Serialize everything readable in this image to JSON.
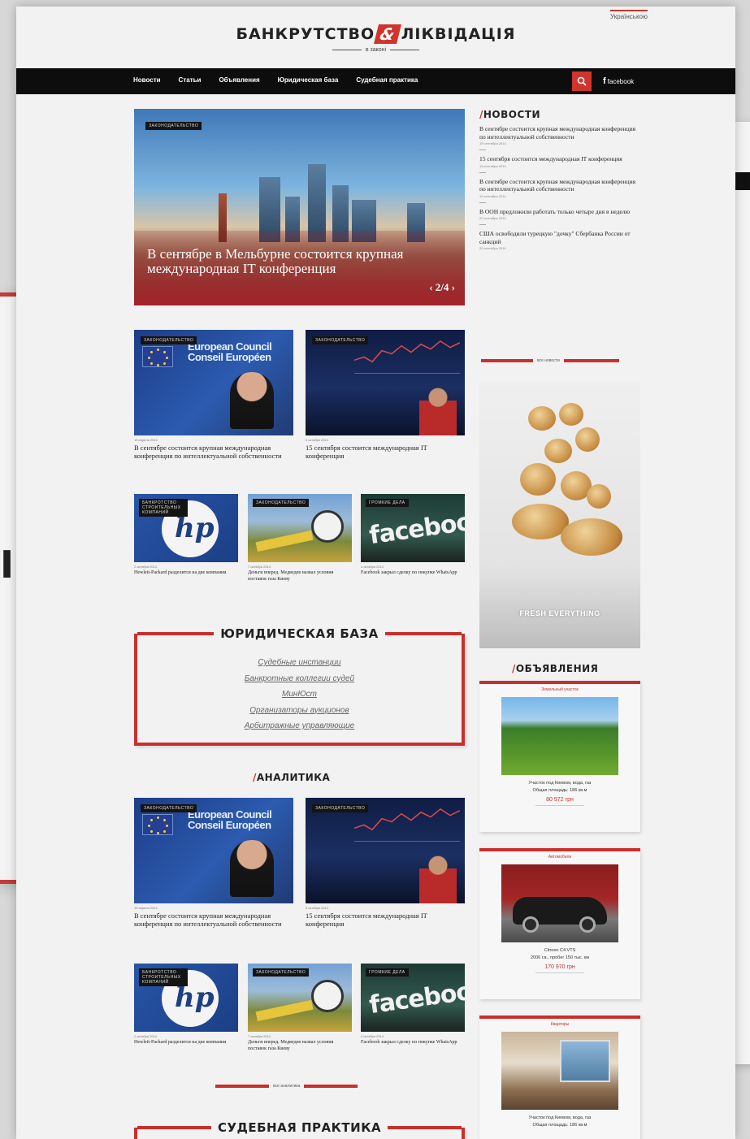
{
  "lang": "Українською",
  "logo": {
    "part1": "БАНКРУТСТВО",
    "amp": "&",
    "part2": "ЛІКВІДАЦІЯ",
    "subtitle": "в законі"
  },
  "nav": {
    "items": [
      "Новости",
      "Статьи",
      "Объявления",
      "Юридическая база",
      "Судебная практика"
    ],
    "facebook": "facebook"
  },
  "hero": {
    "tag": "законодательство",
    "title": "В сентябре в Мельбурне состоится крупная международная IT конференция",
    "pager": "2/4"
  },
  "articles_top": [
    {
      "tag": "законодательство",
      "date": "19 апреля 2014",
      "title": "В сентябре состоится крупная международная конференция по интеллектуальной собственности"
    },
    {
      "tag": "законодательство",
      "date": "3 октября 2014",
      "title": "15 сентября состоится международная IT конференция"
    }
  ],
  "articles_small": [
    {
      "tag": "банкротство строительных компаний",
      "date": "2 октября 2014",
      "title": "Hewlett-Packard разделится на две компании"
    },
    {
      "tag": "законодательство",
      "date": "7 октября 2014",
      "title": "Деньги вперед. Медведев назвал условия поставок газа Киеву"
    },
    {
      "tag": "громкие дела",
      "date": "4 октября 2014",
      "title": "Facebook закрыл сделку по покупке WhatsApp"
    }
  ],
  "legal_base": {
    "title": "ЮРИДИЧЕСКАЯ БАЗА",
    "links": [
      "Судебные инстанции",
      "Банкротные коллегии судей",
      "МинЮст",
      "Организаторы аукционов",
      "Арбитражные управляющие"
    ]
  },
  "analytics": {
    "title": "АНАЛИТИКА",
    "top": [
      {
        "tag": "законодательство",
        "date": "19 апреля 2014",
        "title": "В сентябре состоится крупная международная конференция по интеллектуальной собственности"
      },
      {
        "tag": "законодательство",
        "date": "3 октября 2014",
        "title": "15 сентября состоится международная IT конференция"
      }
    ],
    "small": [
      {
        "tag": "банкротство строительных компаний",
        "date": "2 октября 2014",
        "title": "Hewlett-Packard разделится на две компании"
      },
      {
        "tag": "законодательство",
        "date": "7 октября 2014",
        "title": "Деньги вперед. Медведев назвал условия поставок газа Киеву"
      },
      {
        "tag": "громкие дела",
        "date": "4 октября 2014",
        "title": "Facebook закрыл сделку по покупке WhatsApp"
      }
    ],
    "more": "все аналитика"
  },
  "court_practice": {
    "title": "СУДЕБНАЯ ПРАКТИКА"
  },
  "news": {
    "title": "НОВОСТИ",
    "items": [
      {
        "title": "В сентябре состоится крупная международная конференция по интеллектуальной собственности",
        "date": "19 сентября 2014"
      },
      {
        "title": "15 сентября состоится международная IT конференция",
        "date": "15 сентября 2014"
      },
      {
        "title": "В сентябре состоится крупная международная конференция по интеллектуальной собственности",
        "date": "19 сентября 2014"
      },
      {
        "title": "В ООН предложили работать только четыре дня в неделю",
        "date": "20 сентября 2014"
      },
      {
        "title": "США освободили турецкую \"дочку\" Сбербанка России от санкций",
        "date": "20 сентября 2014"
      }
    ],
    "more": "все новости"
  },
  "ad": {
    "text": "FRESH EVERYTHING"
  },
  "classifieds": {
    "title": "ОБЪЯВЛЕНИЯ",
    "items": [
      {
        "category": "Земельный участок",
        "desc": [
          "Участок под Киевом, вода, газ",
          "Общая площадь: 186 кв.м"
        ],
        "price": "80 972 грн"
      },
      {
        "category": "Автомобили",
        "desc": [
          "Citroen C4 VTS",
          "2006 г.в., пробег 150 тыс. км"
        ],
        "price": "170 970 грн"
      },
      {
        "category": "Квартиры",
        "desc": [
          "Участок под Киевом, вода, газ",
          "Общая площадь: 186 кв.м"
        ],
        "price": ""
      }
    ]
  },
  "background": {
    "left_fragment": "ІЯ"
  },
  "colors": {
    "accent": "#c9302c",
    "nav_bg": "#0d0d0d",
    "page_bg": "#f2f2f2"
  }
}
